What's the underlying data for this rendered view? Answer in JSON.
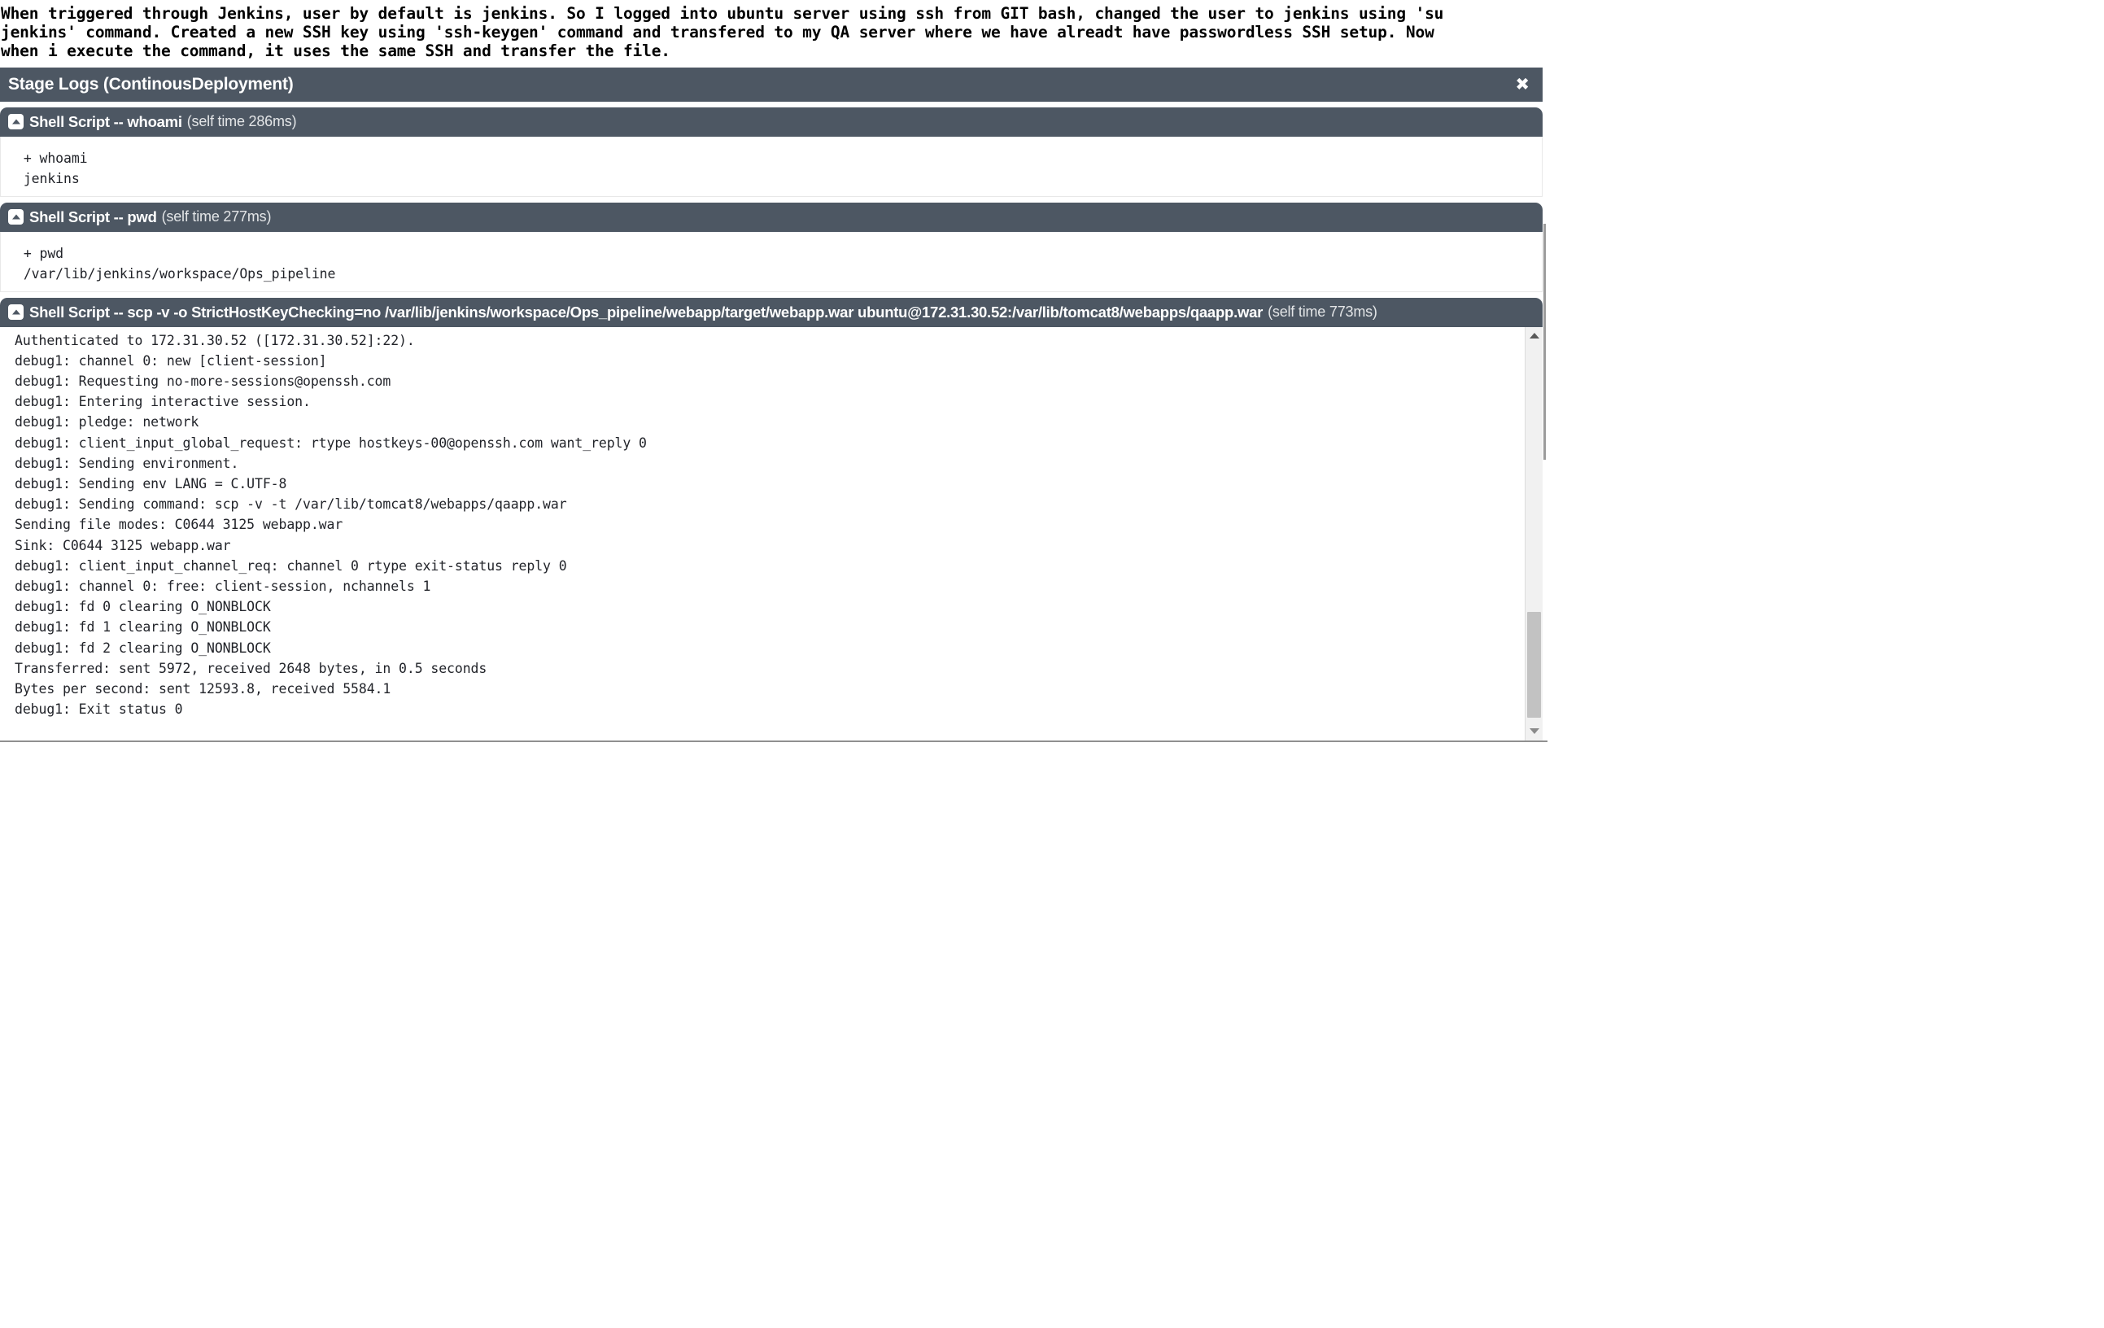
{
  "intro": {
    "text": "When triggered through Jenkins, user by default is jenkins. So I logged into ubuntu server using ssh from GIT bash, changed the user to jenkins using 'su\njenkins' command. Created a new SSH key using 'ssh-keygen' command and transfered to my QA server where we have alreadt have passwordless SSH setup. Now\nwhen i execute the command, it uses the same SSH and transfer the file."
  },
  "dialog": {
    "title": "Stage Logs (ContinousDeployment)",
    "close_label": "✖",
    "close_icon": "close-icon"
  },
  "colors": {
    "header_bg": "#4d5763",
    "header_text": "#ffffff",
    "body_bg": "#ffffff",
    "log_text": "#22242a",
    "scroll_thumb": "#c2c2c2",
    "scroll_track": "#f1f1f1"
  },
  "steps": [
    {
      "icon": "collapse-icon",
      "title": "Shell Script -- whoami",
      "self_time": "(self time 286ms)",
      "lines": [
        " + whoami",
        " jenkins"
      ]
    },
    {
      "icon": "collapse-icon",
      "title": "Shell Script -- pwd",
      "self_time": "(self time 277ms)",
      "lines": [
        " + pwd",
        " /var/lib/jenkins/workspace/Ops_pipeline"
      ]
    },
    {
      "icon": "collapse-icon",
      "title": "Shell Script -- scp -v -o StrictHostKeyChecking=no /var/lib/jenkins/workspace/Ops_pipeline/webapp/target/webapp.war ubuntu@172.31.30.52:/var/lib/tomcat8/webapps/qaapp.war",
      "self_time": "(self time 773ms)",
      "lines": [
        "Authenticated to 172.31.30.52 ([172.31.30.52]:22).",
        "debug1: channel 0: new [client-session]",
        "debug1: Requesting no-more-sessions@openssh.com",
        "debug1: Entering interactive session.",
        "debug1: pledge: network",
        "debug1: client_input_global_request: rtype hostkeys-00@openssh.com want_reply 0",
        "debug1: Sending environment.",
        "debug1: Sending env LANG = C.UTF-8",
        "debug1: Sending command: scp -v -t /var/lib/tomcat8/webapps/qaapp.war",
        "Sending file modes: C0644 3125 webapp.war",
        "Sink: C0644 3125 webapp.war",
        "debug1: client_input_channel_req: channel 0 rtype exit-status reply 0",
        "debug1: channel 0: free: client-session, nchannels 1",
        "debug1: fd 0 clearing O_NONBLOCK",
        "debug1: fd 1 clearing O_NONBLOCK",
        "debug1: fd 2 clearing O_NONBLOCK",
        "Transferred: sent 5972, received 2648 bytes, in 0.5 seconds",
        "Bytes per second: sent 12593.8, received 5584.1",
        "debug1: Exit status 0"
      ]
    }
  ]
}
